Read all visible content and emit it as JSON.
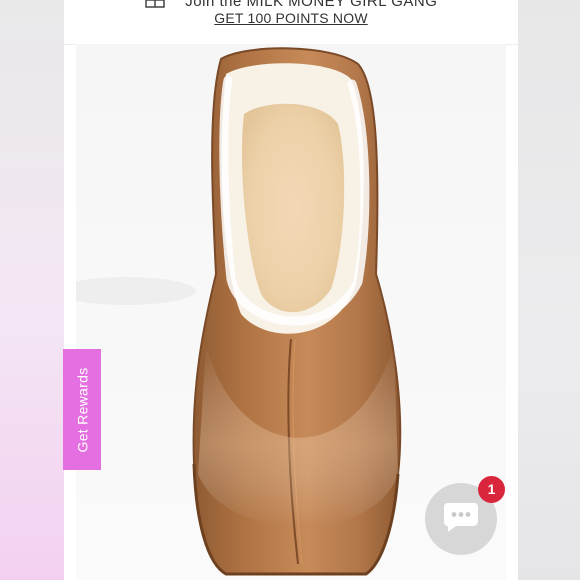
{
  "promo": {
    "headline": "Join the MILK MONEY GIRL GANG",
    "link": "GET 100 POINTS NOW",
    "icon": "gift-icon"
  },
  "product_image": {
    "subject": "tan leather clog with shearling lining"
  },
  "rewards": {
    "label": "Get Rewards",
    "color": "#e46fe0"
  },
  "chat": {
    "icon": "chat-bubble-icon",
    "badge": "1",
    "badge_color": "#d9263d"
  }
}
